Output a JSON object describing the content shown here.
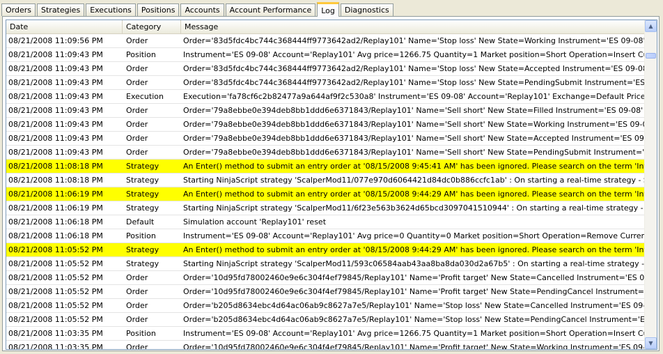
{
  "tabs": [
    {
      "label": "Orders"
    },
    {
      "label": "Strategies"
    },
    {
      "label": "Executions"
    },
    {
      "label": "Positions"
    },
    {
      "label": "Accounts"
    },
    {
      "label": "Account Performance"
    },
    {
      "label": "Log"
    },
    {
      "label": "Diagnostics"
    }
  ],
  "active_tab": "Log",
  "log": {
    "columns": {
      "date": "Date",
      "category": "Category",
      "message": "Message"
    },
    "highlight_color": "#ffff00",
    "rows": [
      {
        "date": "08/21/2008 11:09:56 PM",
        "category": "Order",
        "message": "Order='83d5fdc4bc744c368444ff9773642ad2/Replay101' Name='Stop loss' New State=Working Instrument='ES 09-08' Action=Buy"
      },
      {
        "date": "08/21/2008 11:09:43 PM",
        "category": "Position",
        "message": "Instrument='ES 09-08' Account='Replay101' Avg price=1266.75 Quantity=1 Market position=Short Operation=Insert Currency=Unkn"
      },
      {
        "date": "08/21/2008 11:09:43 PM",
        "category": "Order",
        "message": "Order='83d5fdc4bc744c368444ff9773642ad2/Replay101' Name='Stop loss' New State=Accepted Instrument='ES 09-08' Action=Buy"
      },
      {
        "date": "08/21/2008 11:09:43 PM",
        "category": "Order",
        "message": "Order='83d5fdc4bc744c368444ff9773642ad2/Replay101' Name='Stop loss' New State=PendingSubmit Instrument='ES 09-08' Actio"
      },
      {
        "date": "08/21/2008 11:09:43 PM",
        "category": "Execution",
        "message": "Execution='fa78cf6c2b82477a9a644af9f2c530a8' Instrument='ES 09-08' Account='Replay101' Exchange=Default Price=1266.75 Qu"
      },
      {
        "date": "08/21/2008 11:09:43 PM",
        "category": "Order",
        "message": "Order='79a8ebbe0e394deb8bb1ddd6e6371843/Replay101' Name='Sell short' New State=Filled Instrument='ES 09-08' Action=SellS"
      },
      {
        "date": "08/21/2008 11:09:43 PM",
        "category": "Order",
        "message": "Order='79a8ebbe0e394deb8bb1ddd6e6371843/Replay101' Name='Sell short' New State=Working Instrument='ES 09-08' Action=Se"
      },
      {
        "date": "08/21/2008 11:09:43 PM",
        "category": "Order",
        "message": "Order='79a8ebbe0e394deb8bb1ddd6e6371843/Replay101' Name='Sell short' New State=Accepted Instrument='ES 09-08' Action=S"
      },
      {
        "date": "08/21/2008 11:09:43 PM",
        "category": "Order",
        "message": "Order='79a8ebbe0e394deb8bb1ddd6e6371843/Replay101' Name='Sell short' New State=PendingSubmit Instrument='ES 09-08' Act"
      },
      {
        "date": "08/21/2008 11:08:18 PM",
        "category": "Strategy",
        "highlight": true,
        "message": "An Enter() method to submit an entry order at '08/15/2008 9:45:41 AM' has been ignored. Please search on the term 'Internal Order"
      },
      {
        "date": "08/21/2008 11:08:18 PM",
        "category": "Strategy",
        "message": "Starting NinjaScript strategy 'ScalperMod11/077e970d6064421d84dc0b886ccfc1ab' : On starting a real-time strategy - StrategySync"
      },
      {
        "date": "08/21/2008 11:06:19 PM",
        "category": "Strategy",
        "highlight": true,
        "message": "An Enter() method to submit an entry order at '08/15/2008 9:44:29 AM' has been ignored. Please search on the term 'Internal Order"
      },
      {
        "date": "08/21/2008 11:06:19 PM",
        "category": "Strategy",
        "message": "Starting NinjaScript strategy 'ScalperMod11/6f23e563b3624d65bcd3097041510944' : On starting a real-time strategy - StrategySync"
      },
      {
        "date": "08/21/2008 11:06:18 PM",
        "category": "Default",
        "message": "Simulation account 'Replay101' reset"
      },
      {
        "date": "08/21/2008 11:06:18 PM",
        "category": "Position",
        "message": "Instrument='ES 09-08' Account='Replay101' Avg price=0 Quantity=0 Market position=Short Operation=Remove Currency=Unknown"
      },
      {
        "date": "08/21/2008 11:05:52 PM",
        "category": "Strategy",
        "highlight": true,
        "message": "An Enter() method to submit an entry order at '08/15/2008 9:44:29 AM' has been ignored. Please search on the term 'Internal Order"
      },
      {
        "date": "08/21/2008 11:05:52 PM",
        "category": "Strategy",
        "message": "Starting NinjaScript strategy 'ScalperMod11/593c06584aab43aa8ba8da030d2a67b5' : On starting a real-time strategy - StrategySyn"
      },
      {
        "date": "08/21/2008 11:05:52 PM",
        "category": "Order",
        "message": "Order='10d95fd78002460e9e6c304f4ef79845/Replay101' Name='Profit target' New State=Cancelled Instrument='ES 09-08' Action="
      },
      {
        "date": "08/21/2008 11:05:52 PM",
        "category": "Order",
        "message": "Order='10d95fd78002460e9e6c304f4ef79845/Replay101' Name='Profit target' New State=PendingCancel Instrument='ES 09-08' Ac"
      },
      {
        "date": "08/21/2008 11:05:52 PM",
        "category": "Order",
        "message": "Order='b205d8634ebc4d64ac06ab9c8627a7e5/Replay101' Name='Stop loss' New State=Cancelled Instrument='ES 09-08' Action=B"
      },
      {
        "date": "08/21/2008 11:05:52 PM",
        "category": "Order",
        "message": "Order='b205d8634ebc4d64ac06ab9c8627a7e5/Replay101' Name='Stop loss' New State=PendingCancel Instrument='ES 09-08' Acti"
      },
      {
        "date": "08/21/2008 11:03:35 PM",
        "category": "Position",
        "message": "Instrument='ES 09-08' Account='Replay101' Avg price=1266.75 Quantity=1 Market position=Short Operation=Insert Currency=Unkn"
      },
      {
        "date": "08/21/2008 11:03:35 PM",
        "category": "Order",
        "message": "Order='10d95fd78002460e9e6c304f4ef79845/Replay101' Name='Profit target' New State=Working Instrument='ES 09-08' Action=B"
      }
    ]
  },
  "scrollbar": {
    "up_icon": "triangle-up",
    "down_icon": "triangle-down"
  }
}
